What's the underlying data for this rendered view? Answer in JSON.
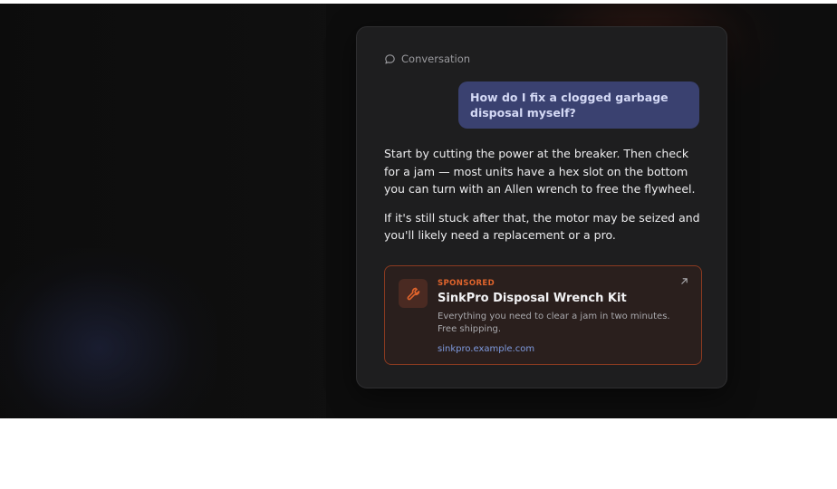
{
  "header": {
    "label": "Conversation",
    "icon": "chat-bubble-icon"
  },
  "conversation": {
    "user_message": "How do I fix a clogged garbage disposal myself?",
    "assistant_paragraphs": [
      "Start by cutting the power at the breaker. Then check for a jam — most units have a hex slot on the bottom you can turn with an Allen wrench to free the flywheel.",
      "If it's still stuck after that, the motor may be seized and you'll likely need a replacement or a pro."
    ]
  },
  "ad": {
    "sponsored_label": "SPONSORED",
    "title": "SinkPro Disposal Wrench Kit",
    "description": "Everything you need to clear a jam in two minutes. Free shipping.",
    "link": "sinkpro.example.com",
    "icon": "wrench-icon",
    "external_icon": "external-link-icon"
  },
  "colors": {
    "user_bubble": "#3a4170",
    "accent": "#e0642c",
    "ad_border": "#8a3a20",
    "link": "#7f9be0"
  }
}
